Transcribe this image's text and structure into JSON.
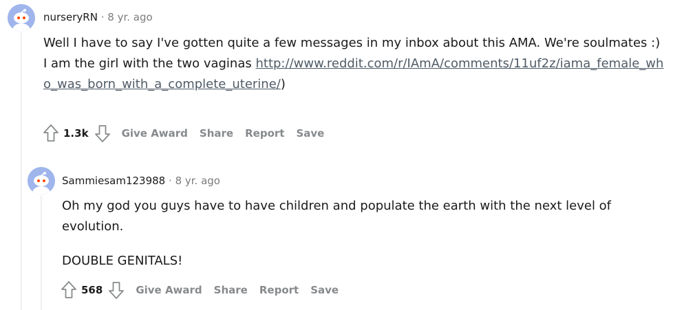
{
  "comments": [
    {
      "author": "nurseryRN",
      "separator": "·",
      "time": "8 yr. ago",
      "text_line": "Well I have to say I've gotten quite a few messages in my inbox about this AMA. We're soulmates :) I am the girl with the two vaginas",
      "link": "http://www.reddit.com/r/IAmA/comments/11uf2z/iama_female_who_was_born_with_a_complete_uterine/",
      "link_close": ")",
      "score": "1.3k",
      "actions": [
        "Give Award",
        "Share",
        "Report",
        "Save"
      ]
    },
    {
      "author": "Sammiesam123988",
      "separator": "·",
      "time": "8 yr. ago",
      "paragraph1": "Oh my god you guys have to have children and populate the earth with the next level of evolution.",
      "paragraph2": "DOUBLE GENITALS!",
      "score": "568",
      "actions": [
        "Give Award",
        "Share",
        "Report",
        "Save"
      ]
    }
  ],
  "icons": {
    "upvote": "arrow-up-outline",
    "downvote": "arrow-down-outline",
    "avatar": "reddit-snoo-avatar"
  },
  "colors": {
    "avatar_bg": "#9fb5ec",
    "meta_gray": "#7c7c7c",
    "action_gray": "#878a8c",
    "thread_line": "#edeff1"
  }
}
